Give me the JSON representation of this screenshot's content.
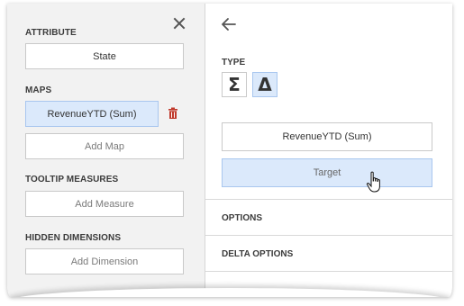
{
  "left": {
    "attribute": {
      "label": "ATTRIBUTE",
      "value": "State"
    },
    "maps": {
      "label": "MAPS",
      "item": "RevenueYTD (Sum)",
      "add_label": "Add Map"
    },
    "tooltip": {
      "label": "TOOLTIP MEASURES",
      "add_label": "Add Measure"
    },
    "hidden": {
      "label": "HIDDEN DIMENSIONS",
      "add_label": "Add Dimension"
    }
  },
  "right": {
    "type_label": "TYPE",
    "type_buttons": [
      {
        "name": "sum",
        "glyph": "Σ"
      },
      {
        "name": "delta",
        "glyph": "Δ"
      }
    ],
    "actual_value": "RevenueYTD (Sum)",
    "target_value": "Target",
    "sections": [
      "OPTIONS",
      "DELTA OPTIONS"
    ]
  },
  "colors": {
    "accent_fill": "#dbe9fb",
    "accent_border": "#a9c7ef",
    "trash": "#c0392b",
    "left_panel": "#f2f2f2"
  },
  "icons": [
    "close-icon",
    "trash-icon",
    "back-arrow-icon",
    "hand-cursor-icon"
  ]
}
